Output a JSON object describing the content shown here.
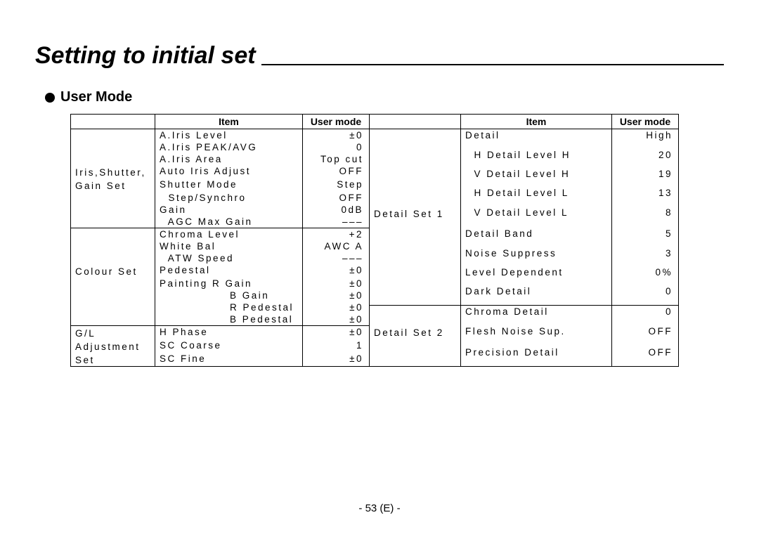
{
  "page_title": "Setting to initial set",
  "section_title": "User Mode",
  "headers": {
    "cat": "",
    "item": "Item",
    "value": "User mode"
  },
  "chart_data": {
    "type": "table",
    "tables": [
      {
        "columns": [
          "",
          "Item",
          "User mode"
        ],
        "groups": [
          {
            "category": [
              "Iris,Shutter,",
              "Gain Set"
            ],
            "rows": [
              {
                "item": "A.Iris Level",
                "indent": 0,
                "value": "±0"
              },
              {
                "item": "A.Iris PEAK/AVG",
                "indent": 0,
                "value": "0"
              },
              {
                "item": "A.Iris Area",
                "indent": 0,
                "value": "Top cut"
              },
              {
                "item": "Auto Iris Adjust",
                "indent": 0,
                "value": "OFF"
              },
              {
                "item": "Shutter Mode",
                "indent": 0,
                "value": "Step"
              },
              {
                "item": "Step/Synchro",
                "indent": 1,
                "value": "OFF"
              },
              {
                "item": "Gain",
                "indent": 0,
                "value": "0dB"
              },
              {
                "item": "AGC Max Gain",
                "indent": 1,
                "value": "–––"
              }
            ]
          },
          {
            "category": [
              "Colour Set"
            ],
            "rows": [
              {
                "item": "Chroma Level",
                "indent": 0,
                "value": "+2"
              },
              {
                "item": "White Bal",
                "indent": 0,
                "value": "AWC A"
              },
              {
                "item": "ATW Speed",
                "indent": 1,
                "value": "–––"
              },
              {
                "item": "Pedestal",
                "indent": 0,
                "value": "±0"
              },
              {
                "item": "Painting R Gain",
                "indent": 0,
                "value": "±0"
              },
              {
                "item": "B Gain",
                "indent": 2,
                "value": "±0"
              },
              {
                "item": "R Pedestal",
                "indent": 2,
                "value": "±0"
              },
              {
                "item": "B Pedestal",
                "indent": 2,
                "value": "±0"
              }
            ]
          },
          {
            "category": [
              "G/L",
              "Adjustment",
              "Set"
            ],
            "rows": [
              {
                "item": "H Phase",
                "indent": 0,
                "value": "±0"
              },
              {
                "item": "SC Coarse",
                "indent": 0,
                "value": "1"
              },
              {
                "item": "SC Fine",
                "indent": 0,
                "value": "±0"
              }
            ]
          }
        ]
      },
      {
        "columns": [
          "",
          "Item",
          "User mode"
        ],
        "groups": [
          {
            "category": [
              "Detail Set 1"
            ],
            "rows": [
              {
                "item": "Detail",
                "indent": 0,
                "value": "High"
              },
              {
                "item": "H Detail Level H",
                "indent": 1,
                "value": "20"
              },
              {
                "item": "V Detail Level H",
                "indent": 1,
                "value": "19"
              },
              {
                "item": "H Detail Level L",
                "indent": 1,
                "value": "13"
              },
              {
                "item": "V Detail Level L",
                "indent": 1,
                "value": "8"
              },
              {
                "item": "Detail Band",
                "indent": 0,
                "value": "5"
              },
              {
                "item": "Noise Suppress",
                "indent": 0,
                "value": "3"
              },
              {
                "item": "Level Dependent",
                "indent": 0,
                "value": "0%"
              },
              {
                "item": "Dark Detail",
                "indent": 0,
                "value": "0"
              }
            ]
          },
          {
            "category": [
              "Detail Set 2"
            ],
            "rows": [
              {
                "item": "Chroma Detail",
                "indent": 0,
                "value": "0"
              },
              {
                "item": "Flesh Noise Sup.",
                "indent": 0,
                "value": "OFF"
              },
              {
                "item": "Precision Detail",
                "indent": 0,
                "value": "OFF"
              }
            ]
          }
        ]
      }
    ]
  },
  "footer": "- 53 (E) -"
}
